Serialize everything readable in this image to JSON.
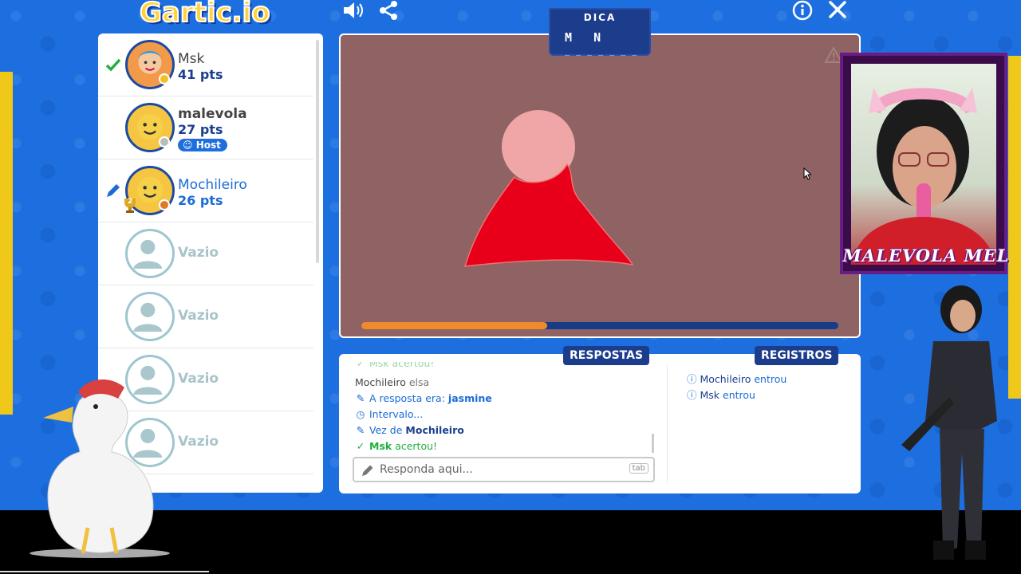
{
  "app": {
    "logo": "Gartic.io"
  },
  "top_icons": {
    "sound": "speaker-icon",
    "share": "share-icon",
    "info": "info-icon",
    "close": "close-icon"
  },
  "hint": {
    "title": "DICA",
    "word": "M  N",
    "blanks": "_ _ _ _ _ _ _"
  },
  "players": [
    {
      "name": "Msk",
      "points": "41 pts",
      "status": "guessed"
    },
    {
      "name": "malevola",
      "points": "27 pts",
      "badge": "Host"
    },
    {
      "name": "Mochileiro",
      "points": "26 pts",
      "status": "drawing",
      "rank": "2"
    },
    {
      "name": "Vazio"
    },
    {
      "name": "Vazio"
    },
    {
      "name": "Vazio"
    },
    {
      "name": "Vazio"
    }
  ],
  "progress": {
    "percent": 39
  },
  "tabs": {
    "answers": "RESPOSTAS",
    "logs": "REGISTROS"
  },
  "chat": {
    "partial_top": "Msk acertou!",
    "msg1_user": "Mochileiro",
    "msg1_text": "elsa",
    "msg2_text": "A resposta era:",
    "msg2_answer": "jasmine",
    "msg3_text": "Intervalo...",
    "msg4_text": "Vez de",
    "msg4_user": "Mochileiro",
    "msg5_user": "Msk",
    "msg5_text": "acertou!",
    "input_placeholder": "Responda aqui...",
    "tab_key": "tab"
  },
  "logs": [
    {
      "user": "Mochileiro",
      "text": "entrou"
    },
    {
      "user": "Msk",
      "text": "entrou"
    }
  ],
  "webcam": {
    "label": "MALEVOLA MEL"
  },
  "colors": {
    "accent": "#1b3f8f",
    "canvas": "#8f6363",
    "progress": "#ef8a2f",
    "success": "#20b040"
  }
}
